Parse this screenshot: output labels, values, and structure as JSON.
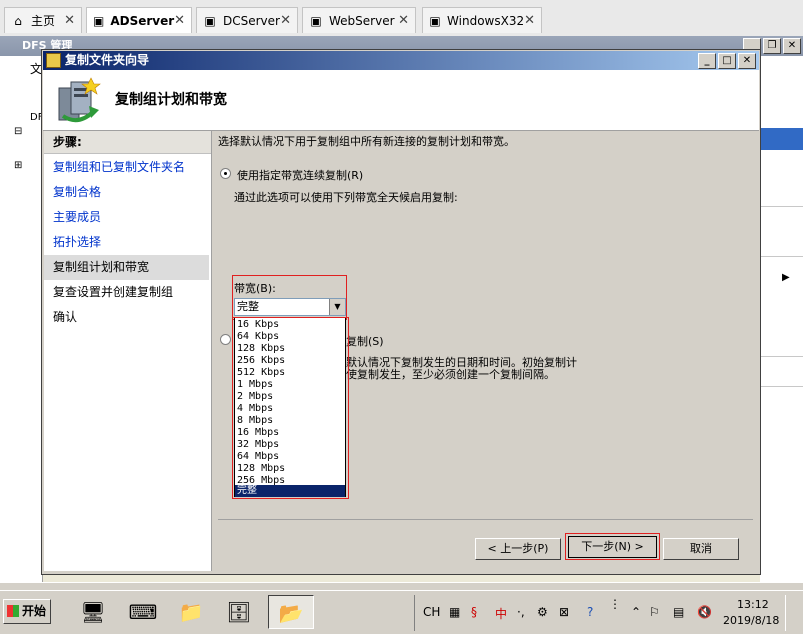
{
  "tabs": [
    {
      "label": "主页",
      "icon": "home-icon"
    },
    {
      "label": "ADServer",
      "icon": "vm-icon",
      "active": true
    },
    {
      "label": "DCServer",
      "icon": "vm-icon"
    },
    {
      "label": "WebServer",
      "icon": "vm-icon"
    },
    {
      "label": "WindowsX32",
      "icon": "vm-icon"
    }
  ],
  "background_window": {
    "title": "DFS 管理",
    "menu_first": "文",
    "tree_first": "DF"
  },
  "wizard": {
    "title": "复制文件夹向导",
    "heading": "复制组计划和带宽",
    "steps_title": "步骤:",
    "steps": [
      "复制组和已复制文件夹名",
      "复制合格",
      "主要成员",
      "拓扑选择",
      "复制组计划和带宽",
      "复查设置并创建复制组",
      "确认"
    ],
    "current_step_index": 4,
    "intro": "选择默认情况下用于复制组中所有新连接的复制计划和带宽。",
    "option1_label": "使用指定带宽连续复制(R)",
    "option1_desc": "通过此选项可以使用下列带宽全天候启用复制:",
    "bandwidth_label": "带宽(B):",
    "bandwidth_value": "完整",
    "bandwidth_options": [
      "16 Kbps",
      "64 Kbps",
      "128 Kbps",
      "256 Kbps",
      "512 Kbps",
      "1 Mbps",
      "2 Mbps",
      "4 Mbps",
      "8 Mbps",
      "16 Mbps",
      "32 Mbps",
      "64 Mbps",
      "128 Mbps",
      "256 Mbps",
      "完整"
    ],
    "option2_label_tail": "复制(S)",
    "option2_desc_line1": "默认情况下复制发生的日期和时间。初始复制计",
    "option2_desc_line2": "使复制发生，至少必须创建一个复制间隔。",
    "buttons": {
      "back": "< 上一步(P)",
      "next": "下一步(N) >",
      "cancel": "取消"
    }
  },
  "taskbar": {
    "start_label": "开始",
    "lang": "CH",
    "ime": "中",
    "time": "13:12",
    "date": "2019/8/18"
  }
}
